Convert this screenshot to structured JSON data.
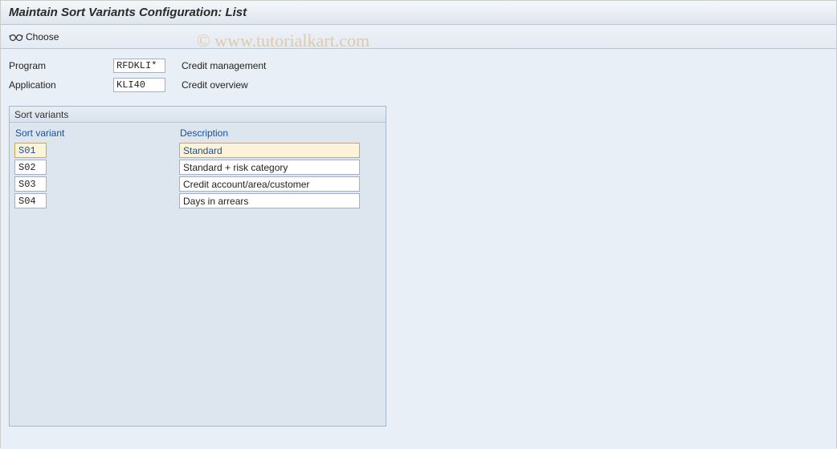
{
  "title": "Maintain Sort Variants Configuration: List",
  "toolbar": {
    "choose_label": "Choose"
  },
  "fields": {
    "program_label": "Program",
    "program_value": "RFDKLI*",
    "program_text": "Credit management",
    "application_label": "Application",
    "application_value": "KLI40",
    "application_text": "Credit overview"
  },
  "panel": {
    "title": "Sort variants",
    "col_variant": "Sort variant",
    "col_description": "Description",
    "rows": [
      {
        "variant": "S01",
        "description": "Standard"
      },
      {
        "variant": "S02",
        "description": "Standard + risk category"
      },
      {
        "variant": "S03",
        "description": "Credit account/area/customer"
      },
      {
        "variant": "S04",
        "description": "Days in arrears"
      }
    ]
  },
  "watermark": "© www.tutorialkart.com"
}
